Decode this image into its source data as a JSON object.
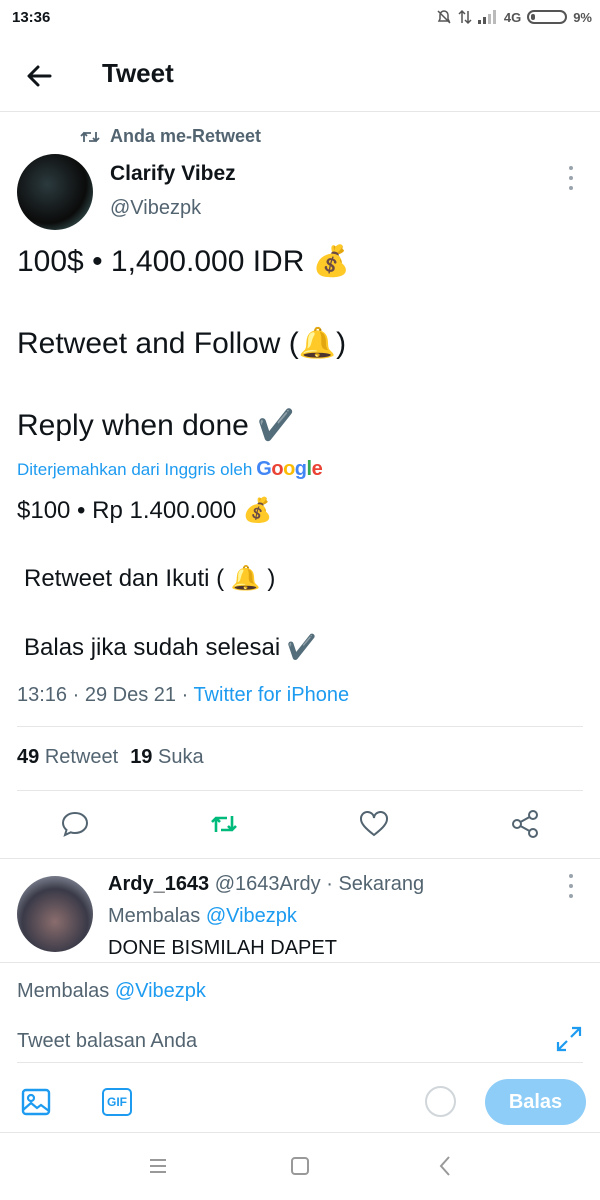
{
  "status_bar": {
    "time": "13:36",
    "network": "4G",
    "battery": "9%"
  },
  "header": {
    "title": "Tweet"
  },
  "retweet_context": {
    "label": "Anda me-Retweet"
  },
  "tweet": {
    "author_name": "Clarify Vibez",
    "author_handle": "@Vibezpk",
    "lines": [
      "100$ • 1,400.000 IDR 💰",
      "Retweet and Follow (🔔)",
      "Reply when done ✔️"
    ],
    "translated_by": "Diterjemahkan dari Inggris oleh",
    "translator_brand": "Google",
    "translation_lines": [
      "$100 • Rp 1.400.000 💰",
      "Retweet dan Ikuti ( 🔔 )",
      "Balas jika sudah selesai ✔️"
    ],
    "time": "13:16",
    "date": "29 Des 21",
    "source": "Twitter for iPhone",
    "retweets_count": "49",
    "retweets_label": "Retweet",
    "likes_count": "19",
    "likes_label": "Suka"
  },
  "actions": [
    "reply-icon",
    "retweet-icon",
    "like-icon",
    "share-icon"
  ],
  "reply": {
    "author_name": "Ardy_1643",
    "author_handle": "@1643Ardy",
    "time": "Sekarang",
    "replying_prefix": "Membalas",
    "replying_to": "@Vibezpk",
    "text": "DONE BISMILAH DAPET"
  },
  "composer": {
    "replying_prefix": "Membalas",
    "replying_to": "@Vibezpk",
    "placeholder": "Tweet balasan Anda",
    "gif_label": "GIF",
    "submit_label": "Balas"
  },
  "colors": {
    "accent": "#1d9bf0",
    "retweet_green": "#00ba7c",
    "muted": "#536471",
    "button_disabled": "#8ecdf7"
  }
}
